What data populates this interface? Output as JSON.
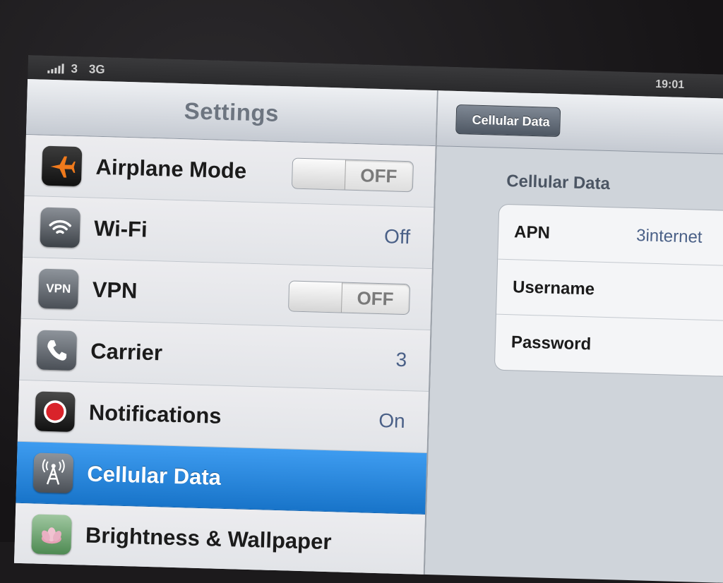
{
  "status_bar": {
    "carrier": "3",
    "network": "3G",
    "time": "19:01"
  },
  "master": {
    "title": "Settings",
    "items": [
      {
        "label": "Airplane Mode",
        "icon": "airplane-icon",
        "control": "toggle",
        "value": "OFF"
      },
      {
        "label": "Wi-Fi",
        "icon": "wifi-icon",
        "control": "value",
        "value": "Off"
      },
      {
        "label": "VPN",
        "icon": "vpn-icon",
        "icon_text": "VPN",
        "control": "toggle",
        "value": "OFF"
      },
      {
        "label": "Carrier",
        "icon": "phone-icon",
        "control": "value",
        "value": "3"
      },
      {
        "label": "Notifications",
        "icon": "notifications-icon",
        "control": "value",
        "value": "On"
      },
      {
        "label": "Cellular Data",
        "icon": "cellular-antenna-icon",
        "selected": true
      },
      {
        "label": "Brightness & Wallpaper",
        "icon": "wallpaper-icon"
      }
    ]
  },
  "detail": {
    "back_button": "Cellular Data",
    "section_title": "Cellular Data",
    "fields": [
      {
        "label": "APN",
        "value": "3internet"
      },
      {
        "label": "Username",
        "value": ""
      },
      {
        "label": "Password",
        "value": ""
      }
    ]
  },
  "colors": {
    "selection_blue": "#1874c9",
    "value_blue": "#4a6087",
    "header_gray": "#c5cad2"
  }
}
